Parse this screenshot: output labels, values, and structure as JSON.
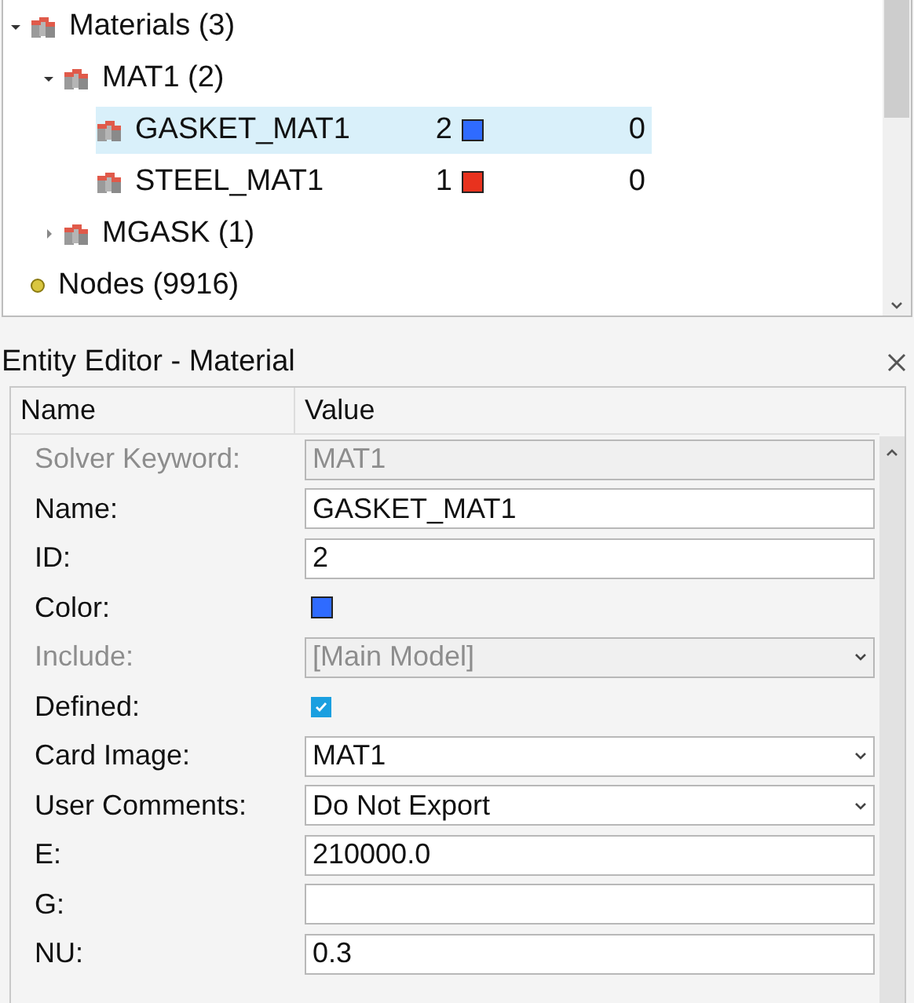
{
  "tree": [
    {
      "label": "Materials (3)",
      "kind": "material",
      "expanded": true,
      "selected": false,
      "children": [
        {
          "label": "MAT1 (2)",
          "kind": "material",
          "expanded": true,
          "selected": false,
          "children": [
            {
              "label": "GASKET_MAT1",
              "kind": "material",
              "selected": true,
              "id": "2",
              "color": "#2f6bff",
              "column_4": "0"
            },
            {
              "label": "STEEL_MAT1",
              "kind": "material",
              "selected": false,
              "id": "1",
              "color": "#e8321e",
              "column_4": "0"
            }
          ]
        },
        {
          "label": "MGASK (1)",
          "kind": "material",
          "expanded": false,
          "selected": false
        }
      ]
    },
    {
      "label": "Nodes (9916)",
      "kind": "node",
      "selected": false
    }
  ],
  "editor": {
    "title": "Entity Editor - Material",
    "columns": [
      "Name",
      "Value"
    ],
    "rows": [
      {
        "label": "Solver Keyword:",
        "kind": "text",
        "value": "MAT1",
        "disabled": true
      },
      {
        "label": "Name:",
        "kind": "text",
        "value": "GASKET_MAT1",
        "disabled": false
      },
      {
        "label": "ID:",
        "kind": "text",
        "value": "2",
        "disabled": false
      },
      {
        "label": "Color:",
        "kind": "color",
        "color": "#2f6bff",
        "disabled": false
      },
      {
        "label": "Include:",
        "kind": "combo",
        "value": "[Main Model]",
        "disabled": true
      },
      {
        "label": "Defined:",
        "kind": "check",
        "checked": true,
        "disabled": false
      },
      {
        "label": "Card Image:",
        "kind": "combo",
        "value": "MAT1",
        "disabled": false
      },
      {
        "label": "User Comments:",
        "kind": "combo",
        "value": "Do Not Export",
        "disabled": false
      },
      {
        "label": "E:",
        "kind": "text",
        "value": "210000.0",
        "disabled": false
      },
      {
        "label": "G:",
        "kind": "text",
        "value": "",
        "disabled": false
      },
      {
        "label": "NU:",
        "kind": "text",
        "value": "0.3",
        "disabled": false
      }
    ]
  }
}
